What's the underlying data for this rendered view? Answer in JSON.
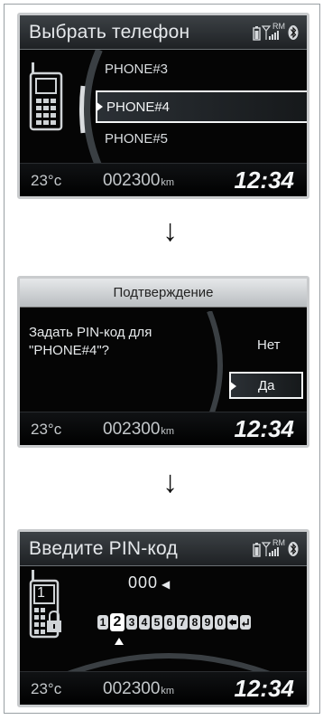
{
  "screens": {
    "select_phone": {
      "title": "Выбрать телефон",
      "phones": [
        "PHONE#3",
        "PHONE#4",
        "PHONE#5"
      ],
      "selected_index": 1
    },
    "confirm": {
      "title": "Подтверждение",
      "question": "Задать PIN-код для\n\"PHONE#4\"?",
      "options": [
        "Нет",
        "Да"
      ],
      "selected_option": "Да"
    },
    "pin_entry": {
      "title": "Введите PIN-код",
      "pin_value": "000",
      "phone_slot_number": "1",
      "digits": [
        "1",
        "2",
        "3",
        "4",
        "5",
        "6",
        "7",
        "8",
        "9",
        "0"
      ],
      "selected_digit": "2"
    }
  },
  "status": {
    "temp": "23°c",
    "odometer": "002300",
    "odometer_unit": "km",
    "time": "12:34",
    "icons": [
      "battery-icon",
      "signal-icon",
      "roaming-icon",
      "bluetooth-icon"
    ],
    "roaming_text": "RM"
  },
  "colors": {
    "screen_bg": "#050505",
    "accent_frame": "#f2f4f5",
    "indicator": "#ffffff"
  }
}
